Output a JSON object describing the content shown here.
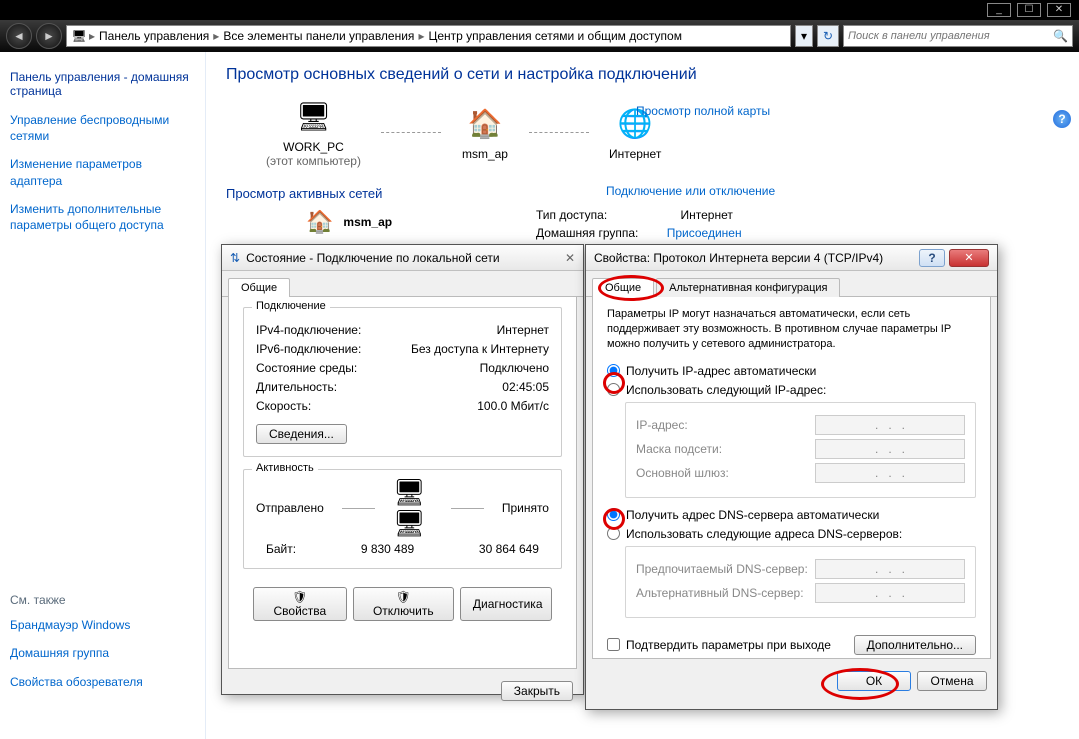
{
  "titlebar": {
    "min": "_",
    "max": "☐",
    "close": "✕"
  },
  "nav": {
    "breadcrumb": [
      "Панель управления",
      "Все элементы панели управления",
      "Центр управления сетями и общим доступом"
    ],
    "search_placeholder": "Поиск в панели управления"
  },
  "sidebar": {
    "home": "Панель управления - домашняя страница",
    "links": [
      "Управление беспроводными сетями",
      "Изменение параметров адаптера",
      "Изменить дополнительные параметры общего доступа"
    ],
    "seealso_label": "См. также",
    "seealso": [
      "Брандмауэр Windows",
      "Домашняя группа",
      "Свойства обозревателя"
    ]
  },
  "main": {
    "heading": "Просмотр основных сведений о сети и настройка подключений",
    "nodes": {
      "pc": "WORK_PC",
      "pc_sub": "(этот компьютер)",
      "ap": "msm_ap",
      "net": "Интернет"
    },
    "viewmap": "Просмотр полной карты",
    "active_label": "Просмотр активных сетей",
    "conn_or_disc": "Подключение или отключение",
    "msm": "msm_ap",
    "type_label": "Тип доступа:",
    "type_val": "Интернет",
    "home_label": "Домашняя группа:",
    "home_val": "Присоединен"
  },
  "status": {
    "title": "Состояние - Подключение по локальной сети",
    "tab": "Общие",
    "group_conn": "Подключение",
    "ipv4_l": "IPv4-подключение:",
    "ipv4_v": "Интернет",
    "ipv6_l": "IPv6-подключение:",
    "ipv6_v": "Без доступа к Интернету",
    "media_l": "Состояние среды:",
    "media_v": "Подключено",
    "dur_l": "Длительность:",
    "dur_v": "02:45:05",
    "spd_l": "Скорость:",
    "spd_v": "100.0 Мбит/с",
    "details": "Сведения...",
    "group_act": "Активность",
    "sent": "Отправлено",
    "recv": "Принято",
    "bytes_l": "Байт:",
    "bytes_sent": "9 830 489",
    "bytes_recv": "30 864 649",
    "props": "Свойства",
    "disable": "Отключить",
    "diag": "Диагностика",
    "close": "Закрыть"
  },
  "ipv4": {
    "title": "Свойства: Протокол Интернета версии 4 (TCP/IPv4)",
    "tab1": "Общие",
    "tab2": "Альтернативная конфигурация",
    "desc": "Параметры IP могут назначаться автоматически, если сеть поддерживает эту возможность. В противном случае параметры IP можно получить у сетевого администратора.",
    "r1": "Получить IP-адрес автоматически",
    "r2": "Использовать следующий IP-адрес:",
    "ip_l": "IP-адрес:",
    "mask_l": "Маска подсети:",
    "gw_l": "Основной шлюз:",
    "r3": "Получить адрес DNS-сервера автоматически",
    "r4": "Использовать следующие адреса DNS-серверов:",
    "dns1_l": "Предпочитаемый DNS-сервер:",
    "dns2_l": "Альтернативный DNS-сервер:",
    "chk": "Подтвердить параметры при выходе",
    "adv": "Дополнительно...",
    "ok": "ОК",
    "cancel": "Отмена"
  }
}
